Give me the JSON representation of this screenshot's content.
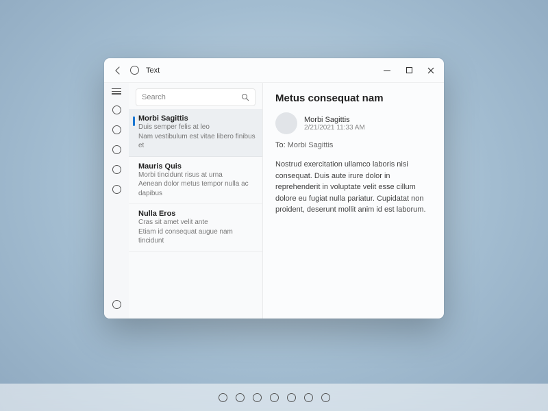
{
  "window": {
    "title": "Text"
  },
  "search": {
    "placeholder": "Search"
  },
  "list": [
    {
      "title": "Morbi Sagittis",
      "line1": "Duis semper felis at leo",
      "line2": "Nam vestibulum est vitae libero finibus et"
    },
    {
      "title": "Mauris Quis",
      "line1": "Morbi tincidunt risus at urna",
      "line2": "Aenean dolor metus tempor nulla ac dapibus"
    },
    {
      "title": "Nulla Eros",
      "line1": "Cras sit amet velit ante",
      "line2": "Etiam id consequat augue nam tincidunt"
    }
  ],
  "detail": {
    "subject": "Metus consequat nam",
    "sender": "Morbi Sagittis",
    "date": "2/21/2021 11:33 AM",
    "to_label": "To:",
    "to_value": "Morbi Sagittis",
    "body": "Nostrud exercitation ullamco laboris nisi consequat. Duis aute irure dolor in reprehenderit in voluptate velit esse cillum dolore eu fugiat nulla pariatur. Cupidatat non proident, deserunt mollit anim id est laborum."
  },
  "taskbar": {
    "icon_count": 7
  }
}
